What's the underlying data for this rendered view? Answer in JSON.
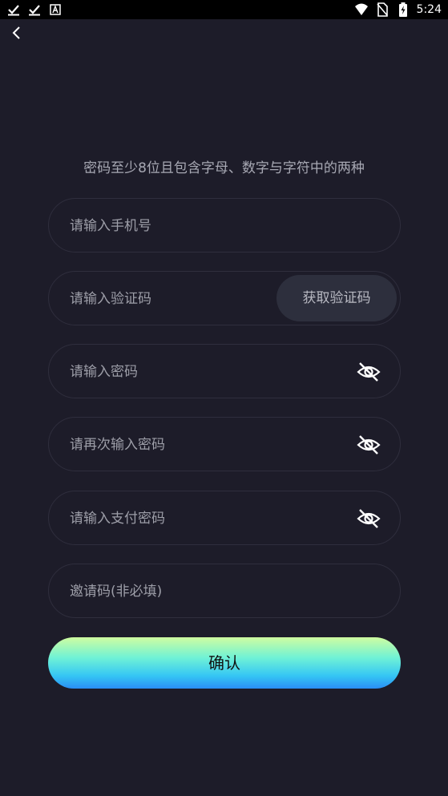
{
  "status_bar": {
    "time": "5:24",
    "left_icons": [
      "check-download-icon",
      "check-download-icon",
      "font-a-icon"
    ],
    "right_icons": [
      "wifi-icon",
      "no-sim-icon",
      "battery-charging-icon"
    ]
  },
  "hint": "密码至少8位且包含字母、数字与字符中的两种",
  "fields": {
    "phone": {
      "placeholder": "请输入手机号"
    },
    "code": {
      "placeholder": "请输入验证码",
      "button_label": "获取验证码"
    },
    "password": {
      "placeholder": "请输入密码",
      "toggle_icon": "eye-off-icon"
    },
    "password_confirm": {
      "placeholder": "请再次输入密码",
      "toggle_icon": "eye-off-icon"
    },
    "pay_password": {
      "placeholder": "请输入支付密码",
      "toggle_icon": "eye-off-icon"
    },
    "invite_code": {
      "placeholder": "邀请码(非必填)"
    }
  },
  "confirm_label": "确认",
  "colors": {
    "background": "#1d1c29",
    "field_border": "#2f2e3d",
    "code_button_bg": "#2d2f3d",
    "confirm_gradient_top": "#cffda0",
    "confirm_gradient_bottom": "#2a8ef5"
  }
}
